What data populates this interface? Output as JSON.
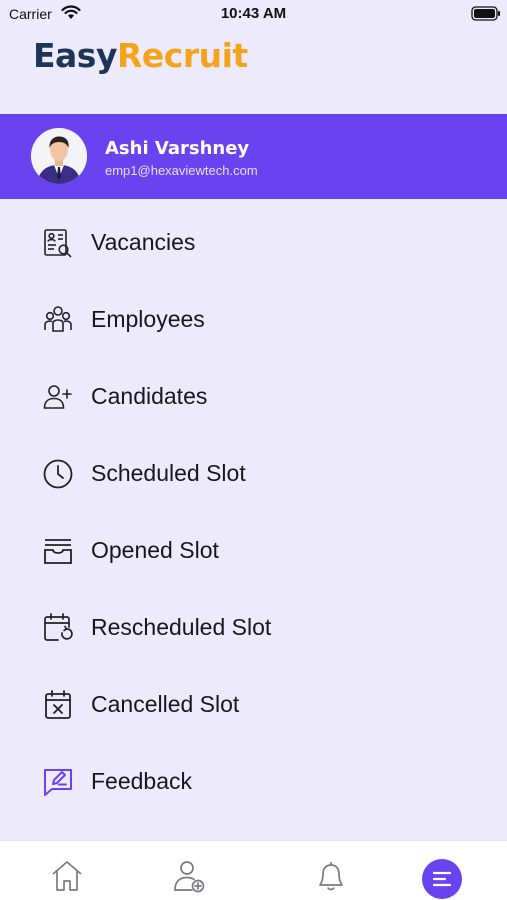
{
  "status_bar": {
    "carrier": "Carrier",
    "time": "10:43 AM"
  },
  "brand": {
    "part1": "Easy",
    "part2": "Recruit",
    "color1": "#1D3557",
    "color2": "#F5A31A"
  },
  "profile": {
    "name": "Ashi Varshney",
    "email": "emp1@hexaviewtech.com",
    "background": "#6A43F0"
  },
  "menu": {
    "items": [
      {
        "label": "Vacancies",
        "icon": "vacancies-icon"
      },
      {
        "label": "Employees",
        "icon": "employees-icon"
      },
      {
        "label": "Candidates",
        "icon": "add-candidate-icon"
      },
      {
        "label": "Scheduled Slot",
        "icon": "clock-icon"
      },
      {
        "label": "Opened Slot",
        "icon": "inbox-icon"
      },
      {
        "label": "Rescheduled Slot",
        "icon": "calendar-reschedule-icon"
      },
      {
        "label": "Cancelled Slot",
        "icon": "calendar-cancel-icon"
      },
      {
        "label": "Feedback",
        "icon": "feedback-icon"
      }
    ]
  },
  "bottom_nav": {
    "tabs": [
      {
        "icon": "home-icon"
      },
      {
        "icon": "add-user-icon"
      },
      {
        "icon": "bell-icon"
      },
      {
        "icon": "menu-icon",
        "active": true
      }
    ]
  },
  "colors": {
    "accent": "#6A43F0",
    "background": "#ECEAFB"
  }
}
